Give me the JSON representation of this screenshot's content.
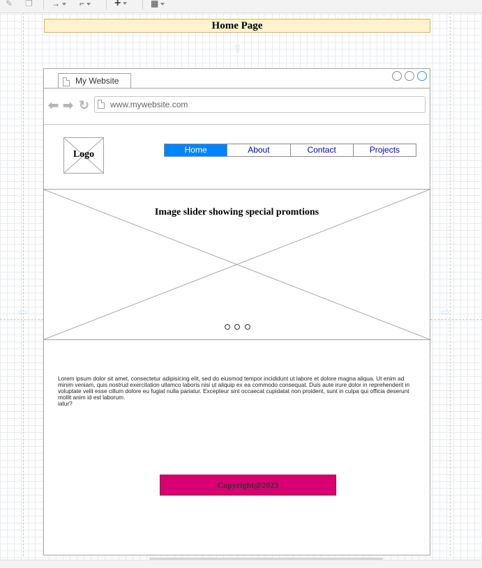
{
  "page_title": "Home Page",
  "browser": {
    "tab_label": "My Website",
    "url": "www.mywebsite.com"
  },
  "logo_label": "Logo",
  "nav": {
    "items": [
      {
        "label": "Home",
        "active": true
      },
      {
        "label": "About",
        "active": false
      },
      {
        "label": "Contact",
        "active": false
      },
      {
        "label": "Projects",
        "active": false
      }
    ],
    "active_color": "#0085fc"
  },
  "slider": {
    "caption": "Image slider showing special promtions",
    "indicator_count": 3
  },
  "body_text": "Lorem ipsum dolor sit amet, consectetur adipisicing elit, sed do eiusmod tempor incididunt ut labore et dolore magna aliqua. Ut enim ad minim veniam, quis nostrud exercitation ullamco laboris nisi ut aliquip ex ea commodo consequat. Duis aute irure dolor in reprehenderit in voluptate velit esse cillum dolore eu fugiat nulla pariatur. Excepteur sint occaecat cupidatat non proident, sunt in culpa qui officia deserunt mollit anim id est laborum.\niatur?",
  "footer": {
    "label": "Copyright@2023",
    "color": "#d80073"
  },
  "title_box_color": "#fff2cc"
}
